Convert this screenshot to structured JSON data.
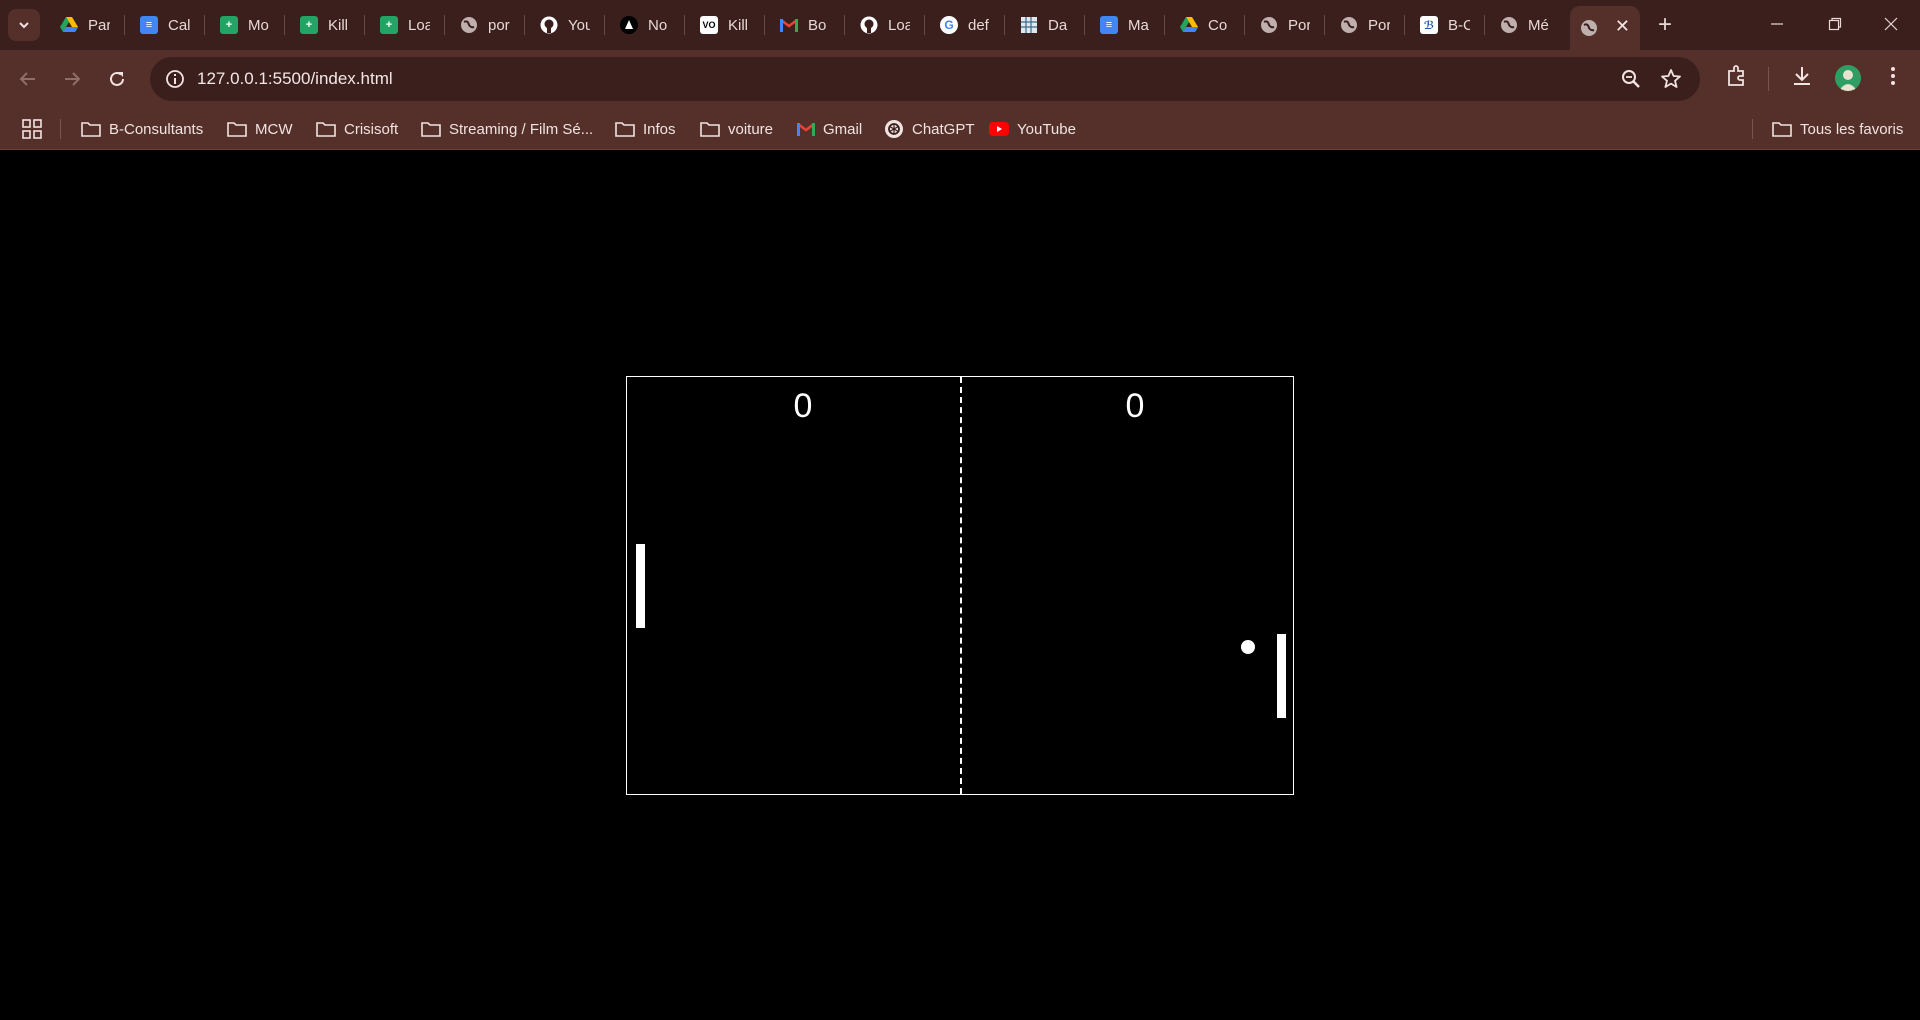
{
  "browser": {
    "tabs": [
      {
        "title": "Par",
        "icon": "google-drive-icon"
      },
      {
        "title": "Cal",
        "icon": "google-docs-icon"
      },
      {
        "title": "Mo",
        "icon": "google-sheets-icon"
      },
      {
        "title": "Kill",
        "icon": "google-sheets-icon"
      },
      {
        "title": "Loa",
        "icon": "google-sheets-icon"
      },
      {
        "title": "por",
        "icon": "globe-icon"
      },
      {
        "title": "You",
        "icon": "github-icon"
      },
      {
        "title": "No",
        "icon": "triangle-logo-icon"
      },
      {
        "title": "Kill",
        "icon": "vo-logo-icon"
      },
      {
        "title": "Bo",
        "icon": "gmail-icon"
      },
      {
        "title": "Loa",
        "icon": "github-icon"
      },
      {
        "title": "def",
        "icon": "google-icon"
      },
      {
        "title": "Da",
        "icon": "calendar-grid-icon"
      },
      {
        "title": "Ma",
        "icon": "google-docs-icon"
      },
      {
        "title": "Co",
        "icon": "google-drive-icon"
      },
      {
        "title": "Por",
        "icon": "globe-icon"
      },
      {
        "title": "Por",
        "icon": "globe-icon"
      },
      {
        "title": "B-C",
        "icon": "link-logo-icon"
      },
      {
        "title": "Mé",
        "icon": "globe-icon"
      }
    ],
    "active_tab_icon": "globe-icon",
    "url": "127.0.0.1:5500/index.html",
    "bookmarks": [
      {
        "label": "B-Consultants",
        "icon": "folder-icon"
      },
      {
        "label": "MCW",
        "icon": "folder-icon"
      },
      {
        "label": "Crisisoft",
        "icon": "folder-icon"
      },
      {
        "label": "Streaming / Film Sé...",
        "icon": "folder-icon"
      },
      {
        "label": "Infos",
        "icon": "folder-icon"
      },
      {
        "label": "voiture",
        "icon": "folder-icon"
      },
      {
        "label": "Gmail",
        "icon": "gmail-icon"
      },
      {
        "label": "ChatGPT",
        "icon": "chatgpt-icon"
      },
      {
        "label": "YouTube",
        "icon": "youtube-icon"
      }
    ],
    "all_bookmarks_label": "Tous les favoris",
    "colors": {
      "frame": "#3a1f1c",
      "toolbar": "#55302b"
    }
  },
  "game": {
    "score_left": "0",
    "score_right": "0",
    "colors": {
      "background": "#000000",
      "foreground": "#ffffff"
    }
  }
}
